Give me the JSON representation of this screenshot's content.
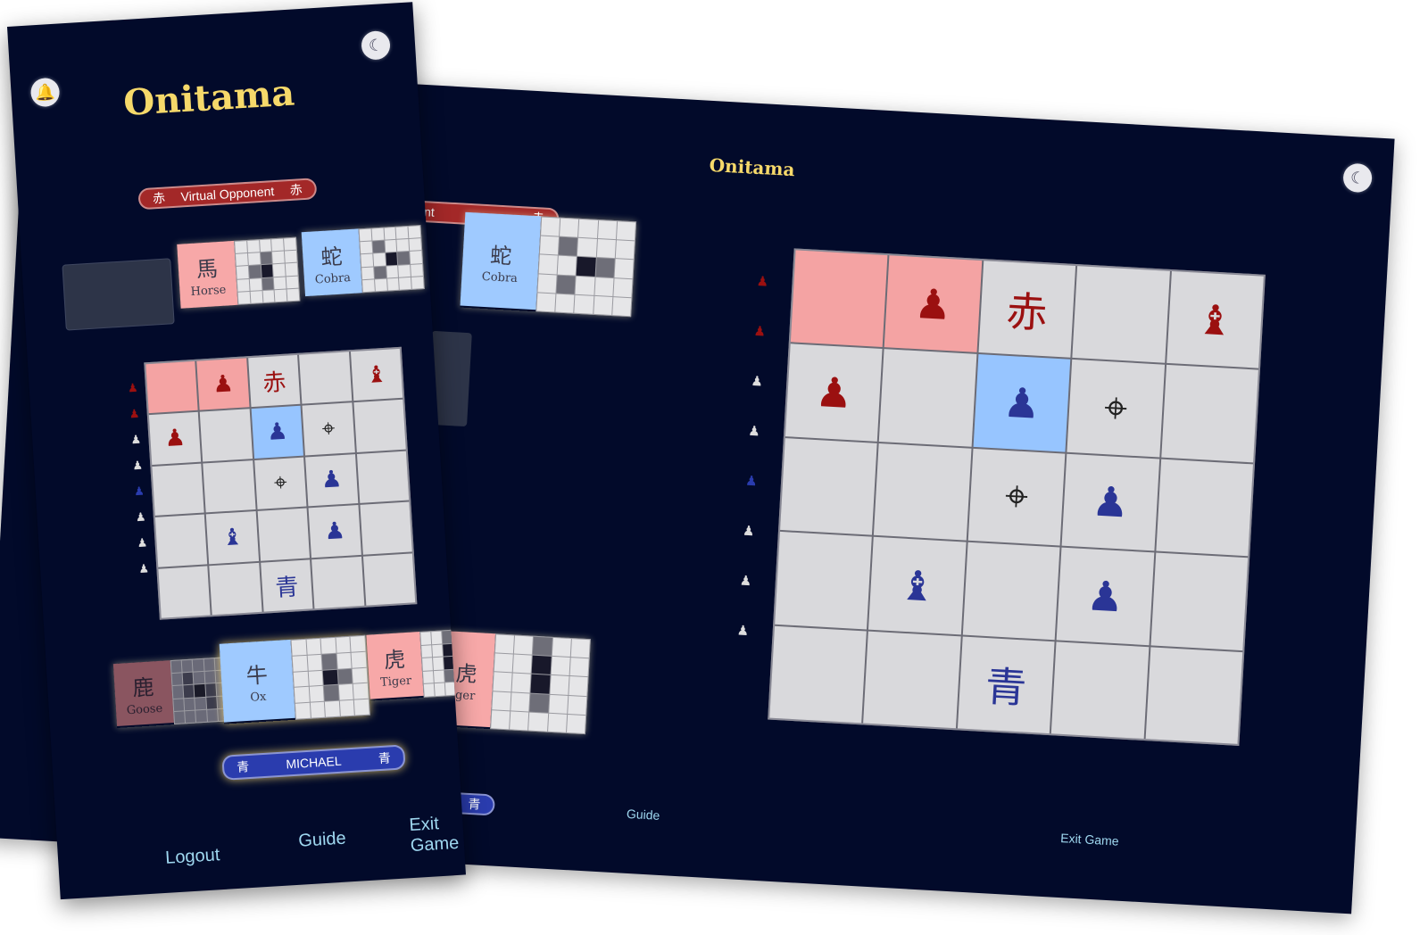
{
  "app": {
    "title": "Onitama"
  },
  "icons": {
    "bell": "bell-icon",
    "moon": "moon-icon"
  },
  "colors": {
    "background": "#020a2a",
    "title": "#f6d96a",
    "red_player": "#a32828",
    "blue_player": "#2a3cae",
    "link": "#9fd8f0"
  },
  "opponent": {
    "kanji": "赤",
    "name": "Virtual Opponent"
  },
  "player": {
    "kanji": "青",
    "name": "MICHAEL"
  },
  "opponent_cards": [
    {
      "kanji": "馬",
      "name": "Horse"
    },
    {
      "kanji": "蛇",
      "name": "Cobra"
    }
  ],
  "player_cards": [
    {
      "kanji": "鹿",
      "name": "Goose"
    },
    {
      "kanji": "牛",
      "name": "Ox"
    },
    {
      "kanji": "虎",
      "name": "Tiger"
    }
  ],
  "board": {
    "red_shrine": "赤",
    "blue_shrine": "青",
    "pawn": "♟",
    "master": "♝",
    "target": "⌖"
  },
  "tablet": {
    "opponent_label": "ent",
    "opponent_kanji": "赤",
    "tiger_label": "ger",
    "player_kanji": "青"
  },
  "nav": {
    "logout": "Logout",
    "guide": "Guide",
    "exit": "Exit Game"
  }
}
